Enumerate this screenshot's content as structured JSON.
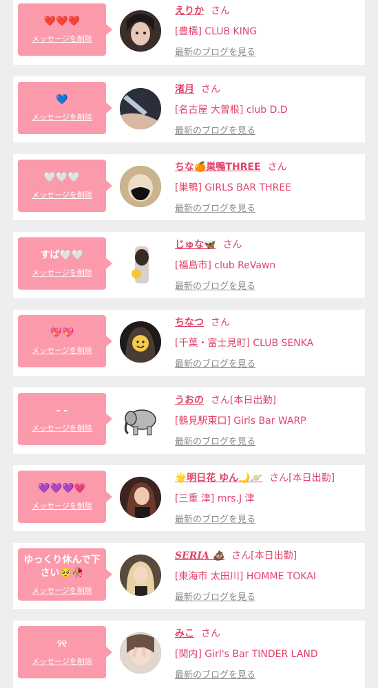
{
  "delete_label": "メッセージを削除",
  "san_label": "さん",
  "blog_label": "最新のブログを見る",
  "colors": {
    "accent": "#fb9aab",
    "name": "#e0436a",
    "muted": "#8a8a8a"
  },
  "cards": [
    {
      "message": "❤️❤️❤️",
      "name": "えりか",
      "status": "",
      "area": "[豊橋] CLUB KING",
      "avatar": "photo-woman"
    },
    {
      "message": "💙",
      "name": "渚月",
      "status": "",
      "area": "[名古屋 大曽根] club D.D",
      "avatar": "photo-arm"
    },
    {
      "message": "🤍🤍🤍",
      "name": "ちな🍊巣鴨THREE",
      "status": "",
      "area": "[巣鴨] GIRLS BAR THREE",
      "avatar": "photo-masked"
    },
    {
      "message": "すば🤍🤍",
      "name": "じゅな🦋",
      "status": "",
      "area": "[福島市] club ReVawn",
      "avatar": "photo-selfie"
    },
    {
      "message": "💖💖",
      "name": "ちなつ",
      "status": "",
      "area": "[千葉・富士見町] CLUB SENKA",
      "avatar": "photo-smiley"
    },
    {
      "message": "- -",
      "name": "うおの",
      "status": "[本日出勤]",
      "area": "[鶴見駅東口] Girls Bar WARP",
      "avatar": "elephant-illustration"
    },
    {
      "message": "💜💜💜💗",
      "name": "🌟明日花 ゆん🌙🪐",
      "status": "[本日出勤]",
      "area": "[三重 津] mrs.J 津",
      "avatar": "photo-woman-dark"
    },
    {
      "message": "ゆっくり休んで下さい🥺🥀",
      "name": "SERIA 💩",
      "status": "[本日出勤]",
      "area": "[東海市 太田川] HOMME TOKAI",
      "avatar": "photo-blonde"
    },
    {
      "message": "୨୧",
      "name": "みこ",
      "status": "",
      "area": "[関内] Girl's Bar TINDER LAND",
      "avatar": "photo-peace"
    }
  ]
}
